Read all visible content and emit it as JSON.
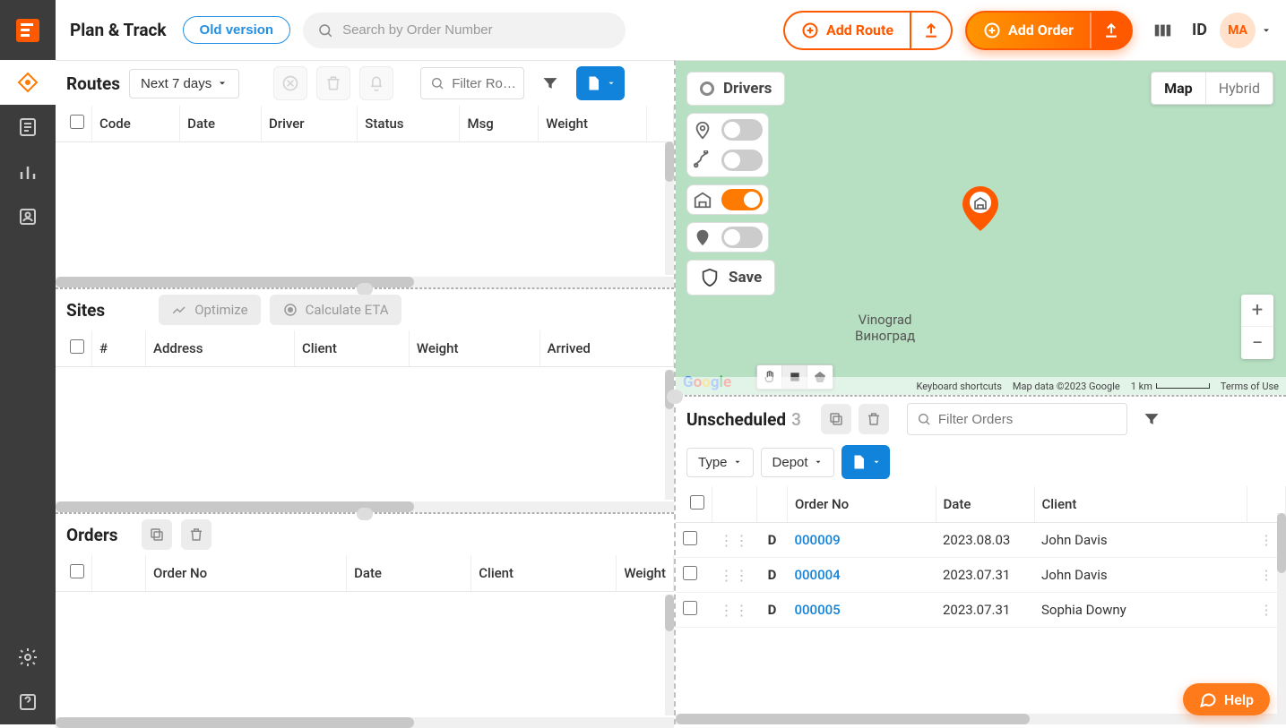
{
  "header": {
    "pageTitle": "Plan & Track",
    "oldVersion": "Old version",
    "searchPlaceholder": "Search by Order Number",
    "addRoute": "Add Route",
    "addOrder": "Add Order",
    "idLabel": "ID",
    "avatarInitials": "MA"
  },
  "routes": {
    "title": "Routes",
    "rangeLabel": "Next 7 days",
    "filterPlaceholder": "Filter Ro…",
    "columns": [
      "Code",
      "Date",
      "Driver",
      "Status",
      "Msg",
      "Weight"
    ]
  },
  "sites": {
    "title": "Sites",
    "optimize": "Optimize",
    "calculateEta": "Calculate ETA",
    "columns": [
      "#",
      "Address",
      "Client",
      "Weight",
      "Arrived"
    ]
  },
  "orders": {
    "title": "Orders",
    "columns": [
      "Order No",
      "Date",
      "Client",
      "Weight"
    ]
  },
  "map": {
    "driversLabel": "Drivers",
    "saveLabel": "Save",
    "mapType": {
      "map": "Map",
      "hybrid": "Hybrid"
    },
    "placeLabel1": "Vinograd",
    "placeLabel2": "Виноград",
    "footer": {
      "shortcuts": "Keyboard shortcuts",
      "attribution": "Map data ©2023 Google",
      "scale": "1 km",
      "terms": "Terms of Use"
    }
  },
  "unscheduled": {
    "title": "Unscheduled",
    "count": "3",
    "filterPlaceholder": "Filter Orders",
    "typeBtn": "Type",
    "depotBtn": "Depot",
    "columns": [
      "Order No",
      "Date",
      "Client"
    ],
    "rows": [
      {
        "badge": "D",
        "orderNo": "000009",
        "date": "2023.08.03",
        "client": "John Davis"
      },
      {
        "badge": "D",
        "orderNo": "000004",
        "date": "2023.07.31",
        "client": "John Davis"
      },
      {
        "badge": "D",
        "orderNo": "000005",
        "date": "2023.07.31",
        "client": "Sophia Downy"
      }
    ]
  },
  "help": {
    "label": "Help"
  }
}
